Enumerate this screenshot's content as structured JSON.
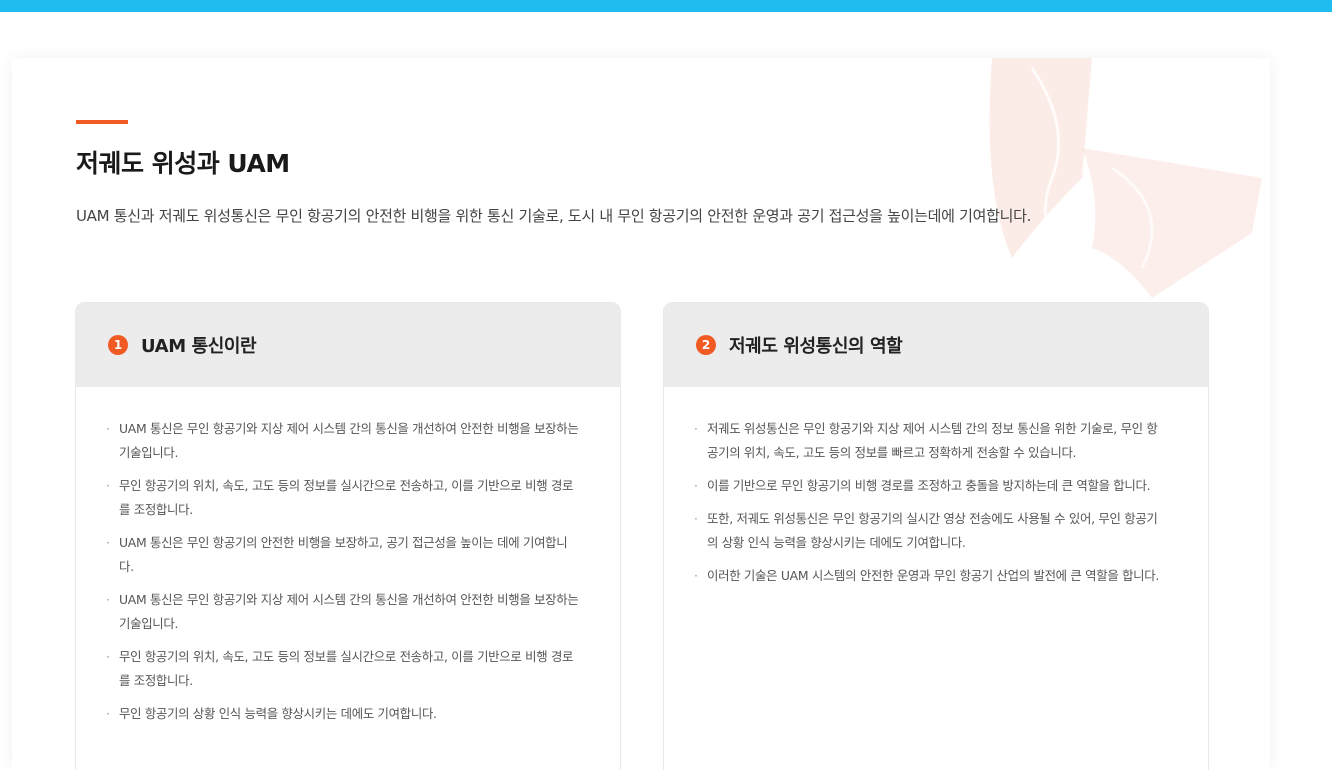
{
  "colors": {
    "top_bar": "#1ebcef",
    "accent": "#f15a22",
    "card_header": "#ececec"
  },
  "section": {
    "title": "저궤도 위성과 UAM",
    "description": "UAM 통신과 저궤도 위성통신은 무인 항공기의 안전한 비행을 위한 통신 기술로, 도시 내 무인 항공기의 안전한 운영과 공기 접근성을 높이는데에 기여합니다."
  },
  "cards": [
    {
      "number": "1",
      "title": "UAM 통신이란",
      "items": [
        "UAM 통신은 무인 항공기와 지상 제어 시스템 간의 통신을 개선하여 안전한 비행을 보장하는 기술입니다.",
        "무인 항공기의 위치, 속도, 고도 등의 정보를 실시간으로 전송하고, 이를 기반으로 비행 경로를 조정합니다.",
        "UAM 통신은 무인 항공기의 안전한 비행을 보장하고, 공기 접근성을 높이는 데에 기여합니다.",
        "UAM 통신은 무인 항공기와 지상 제어 시스템 간의 통신을 개선하여 안전한 비행을 보장하는 기술입니다.",
        "무인 항공기의 위치, 속도, 고도 등의 정보를 실시간으로 전송하고, 이를 기반으로 비행 경로를 조정합니다.",
        "무인 항공기의 상황 인식 능력을 향상시키는 데에도 기여합니다."
      ]
    },
    {
      "number": "2",
      "title": "저궤도 위성통신의 역할",
      "items": [
        "저궤도 위성통신은 무인 항공기와 지상 제어 시스템 간의 정보 통신을 위한 기술로, 무인 항공기의 위치, 속도, 고도 등의 정보를 빠르고 정확하게 전송할 수 있습니다.",
        "이를 기반으로 무인 항공기의 비행 경로를 조정하고 충돌을 방지하는데 큰 역할을 합니다.",
        "또한, 저궤도 위성통신은 무인 항공기의 실시간 영상 전송에도 사용될 수 있어, 무인 항공기의 상황 인식 능력을 향상시키는 데에도 기여합니다.",
        "이러한 기술은 UAM 시스템의 안전한 운영과 무인 항공기 산업의 발전에 큰 역할을 합니다."
      ]
    }
  ]
}
